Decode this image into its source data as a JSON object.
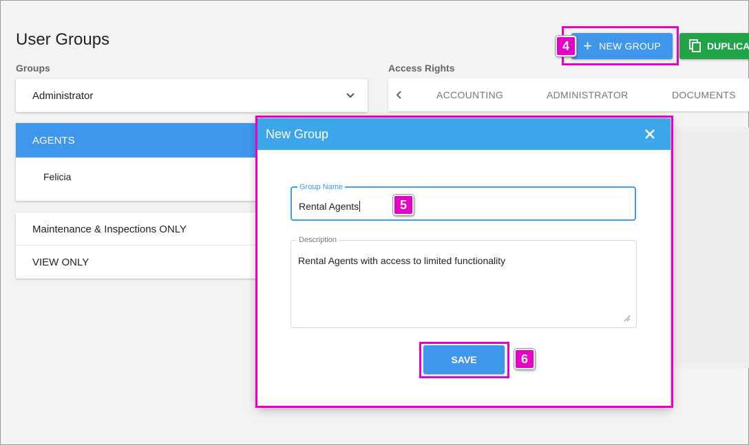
{
  "page": {
    "title": "User Groups"
  },
  "groups": {
    "label": "Groups",
    "selected_dropdown": "Administrator",
    "agents_header": "AGENTS",
    "agents_members": [
      "Felicia"
    ],
    "other_items": [
      "Maintenance & Inspections ONLY",
      "VIEW ONLY"
    ]
  },
  "access_rights": {
    "label": "Access Rights",
    "tabs": [
      "ACCOUNTING",
      "ADMINISTRATOR",
      "DOCUMENTS"
    ]
  },
  "toolbar": {
    "new_group_label": "NEW GROUP",
    "duplicate_label": "DUPLICA"
  },
  "modal": {
    "title": "New Group",
    "group_name_label": "Group Name",
    "group_name_value": "Rental Agents",
    "description_label": "Description",
    "description_value": "Rental Agents with access to limited functionality",
    "save_label": "SAVE"
  },
  "annotations": {
    "step4": "4",
    "step5": "5",
    "step6": "6"
  },
  "colors": {
    "primary": "#3f97ec",
    "modal_header": "#3da6ea",
    "duplicate": "#21a348",
    "highlight": "#e600c8"
  },
  "icons": [
    "plus-icon",
    "copy-icon",
    "chevron-down-icon",
    "chevron-left-icon",
    "close-icon",
    "resize-grip-icon"
  ]
}
